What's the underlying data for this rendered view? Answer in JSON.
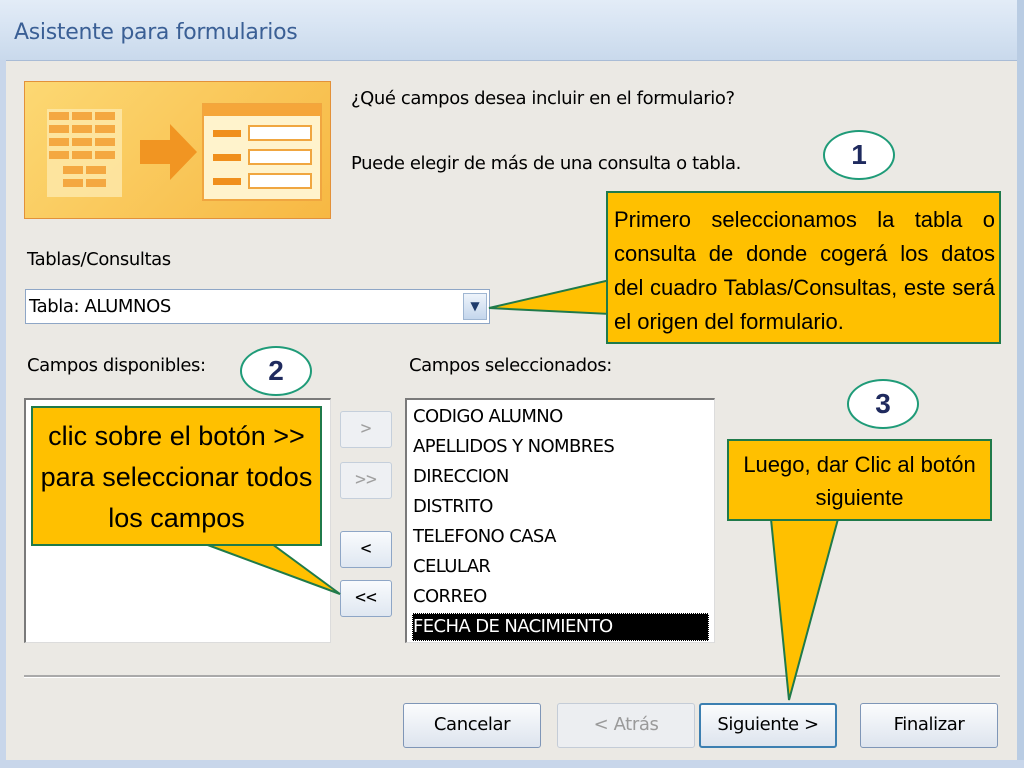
{
  "window": {
    "title": "Asistente para formularios"
  },
  "intro": {
    "question": "¿Qué campos desea incluir en el formulario?",
    "hint": "Puede elegir de más de una consulta o tabla."
  },
  "tables_label": "Tablas/Consultas",
  "tables_combo": {
    "value": "Tabla: ALUMNOS",
    "dropdown_icon": "chevron-down-icon"
  },
  "available": {
    "label": "Campos disponibles:",
    "items": []
  },
  "selected": {
    "label": "Campos seleccionados:",
    "items": [
      "CODIGO ALUMNO",
      "APELLIDOS Y NOMBRES",
      "DIRECCION",
      "DISTRITO",
      "TELEFONO CASA",
      "CELULAR",
      "CORREO",
      "FECHA DE NACIMIENTO"
    ],
    "highlighted": "FECHA DE NACIMIENTO"
  },
  "move_buttons": {
    "add_one": ">",
    "add_all": ">>",
    "remove_one": "<",
    "remove_all": "<<"
  },
  "buttons": {
    "cancel": "Cancelar",
    "back": "< Atrás",
    "next": "Siguiente >",
    "finish": "Finalizar"
  },
  "callouts": {
    "step1": {
      "number": "1",
      "text": "Primero seleccionamos la tabla o consulta de donde cogerá los datos del cuadro Tablas/Consultas, este será el origen del formulario."
    },
    "step2": {
      "number": "2",
      "text": "clic sobre el botón >> para seleccionar todos los campos"
    },
    "step3": {
      "number": "3",
      "text": "Luego, dar Clic al botón siguiente"
    }
  },
  "colors": {
    "callout_fill": "#ffc000",
    "callout_border": "#1f7a4a",
    "title_text": "#3a5f95",
    "number_text": "#1f2a5e"
  }
}
